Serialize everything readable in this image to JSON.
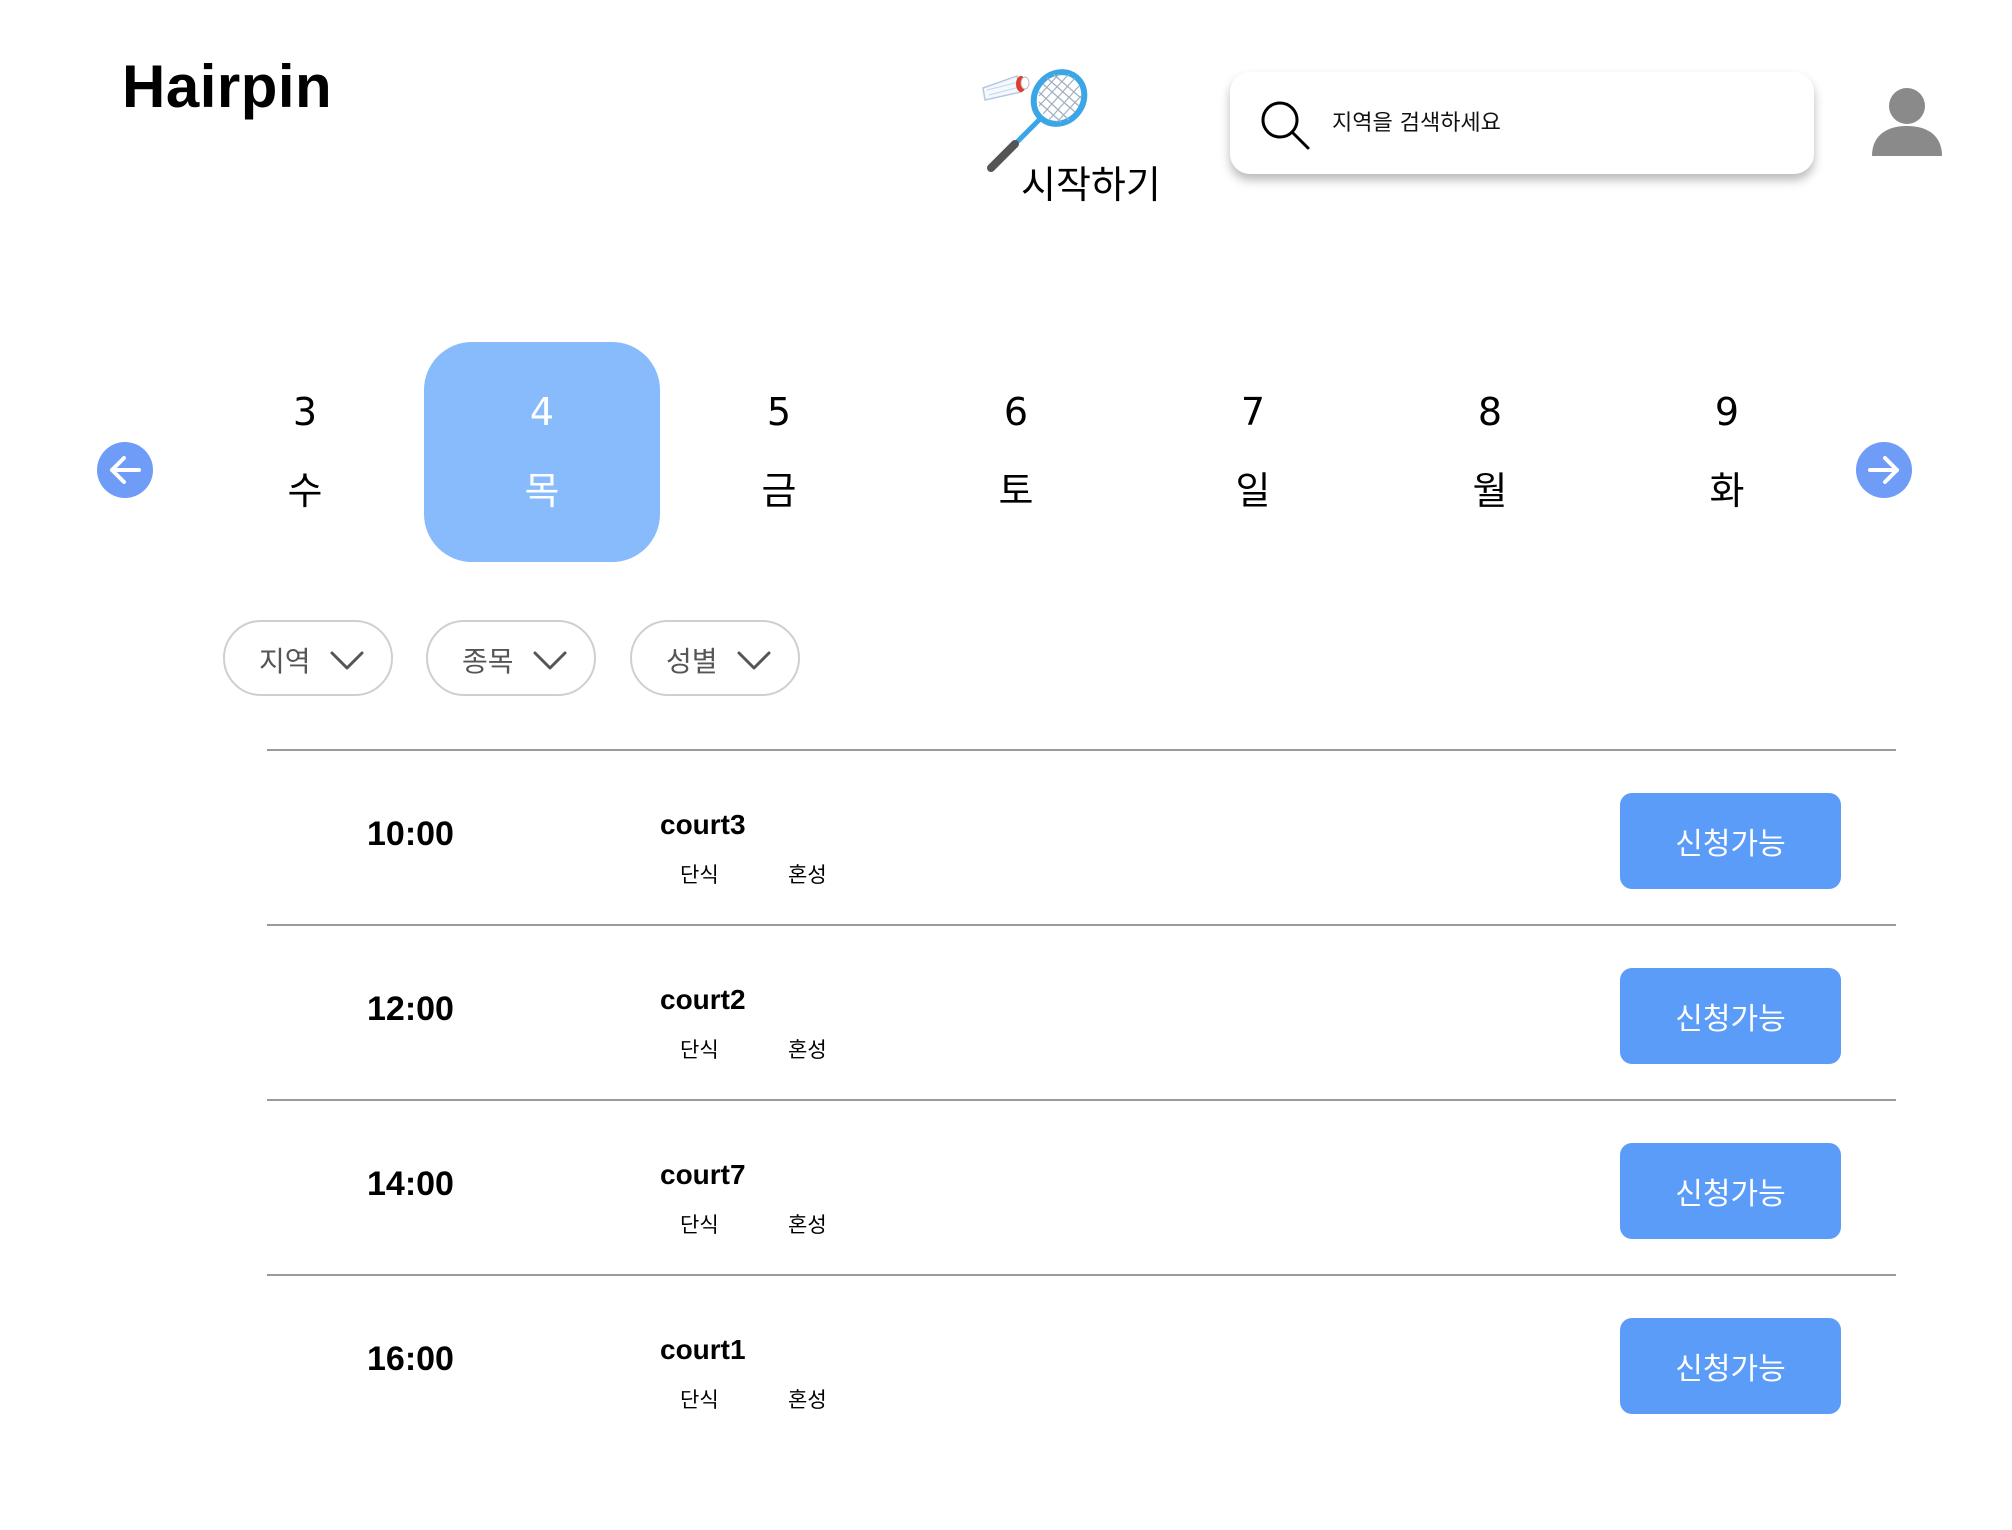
{
  "header": {
    "logo": "Hairpin",
    "start_label": "시작하기",
    "search": {
      "placeholder": "지역을 검색하세요",
      "value": ""
    }
  },
  "dates": [
    {
      "day": "3",
      "weekday": "수",
      "selected": false
    },
    {
      "day": "4",
      "weekday": "목",
      "selected": true
    },
    {
      "day": "5",
      "weekday": "금",
      "selected": false
    },
    {
      "day": "6",
      "weekday": "토",
      "selected": false
    },
    {
      "day": "7",
      "weekday": "일",
      "selected": false
    },
    {
      "day": "8",
      "weekday": "월",
      "selected": false
    },
    {
      "day": "9",
      "weekday": "화",
      "selected": false
    }
  ],
  "filters": [
    {
      "label": "지역"
    },
    {
      "label": "종목"
    },
    {
      "label": "성별"
    }
  ],
  "slots": [
    {
      "time": "10:00",
      "court": "court3",
      "type": "단식",
      "gender": "혼성",
      "status": "신청가능"
    },
    {
      "time": "12:00",
      "court": "court2",
      "type": "단식",
      "gender": "혼성",
      "status": "신청가능"
    },
    {
      "time": "14:00",
      "court": "court7",
      "type": "단식",
      "gender": "혼성",
      "status": "신청가능"
    },
    {
      "time": "16:00",
      "court": "court1",
      "type": "단식",
      "gender": "혼성",
      "status": "신청가능"
    }
  ],
  "colors": {
    "accent": "#5b9cf8",
    "selected_day": "#88bbfb",
    "arrow": "#6f9cf7",
    "divider": "#9a9a9a"
  },
  "icons": {
    "racket": "badminton-racket-icon",
    "search": "search-icon",
    "avatar": "user-avatar-icon",
    "prev": "arrow-left-icon",
    "next": "arrow-right-icon",
    "chevron": "chevron-down-icon"
  }
}
